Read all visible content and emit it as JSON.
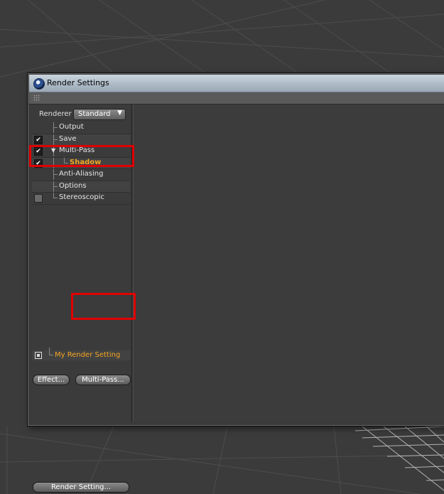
{
  "window": {
    "title": "Render Settings"
  },
  "renderer": {
    "label": "Renderer",
    "value": "Standard"
  },
  "tree": {
    "items": [
      {
        "label": "Output",
        "checked": null
      },
      {
        "label": "Save",
        "checked": true
      },
      {
        "label": "Multi-Pass",
        "checked": true
      },
      {
        "label": "Shadow",
        "checked": true
      },
      {
        "label": "Anti-Aliasing",
        "checked": null
      },
      {
        "label": "Options",
        "checked": null
      },
      {
        "label": "Stereoscopic",
        "checked": false
      }
    ]
  },
  "buttons": {
    "effect": "Effect...",
    "multipass": "Multi-Pass...",
    "render_setting": "Render Setting..."
  },
  "render_settings_list": {
    "items": [
      "My Render Setting"
    ]
  },
  "colors": {
    "highlight": "#e00000",
    "active_text": "#f5a623"
  }
}
